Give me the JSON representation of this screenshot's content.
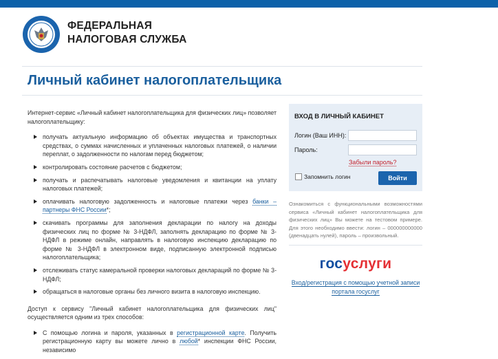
{
  "header": {
    "org_line1": "ФЕДЕРАЛЬНАЯ",
    "org_line2": "НАЛОГОВАЯ СЛУЖБА",
    "logo_icon": "fns-emblem-icon",
    "accent_color": "#0b61a9"
  },
  "page": {
    "title": "Личный кабинет налогоплательщика"
  },
  "intro": "Интернет-сервис «Личный кабинет налогоплательщика для физических лиц» позволяет налогоплательщику:",
  "features": [
    "получать актуальную информацию об объектах имущества и транспортных средствах, о суммах начисленных и уплаченных налоговых платежей, о наличии переплат, о задолженности по налогам перед бюджетом;",
    "контролировать состояние расчетов с бюджетом;",
    "получать и распечатывать налоговые уведомления и квитанции на уплату налоговых платежей;",
    "скачивать программы для заполнения декларации по налогу на доходы физических лиц по форме № 3-НДФЛ, заполнять декларацию по форме № 3-НДФЛ в режиме онлайн, направлять в налоговую инспекцию декларацию по форме № 3-НДФЛ в электронном виде, подписанную электронной подписью налогоплательщика;",
    "отслеживать статус камеральной проверки налоговых деклараций по форме № 3-НДФЛ;",
    "обращаться в налоговые органы без личного визита в налоговую инспекцию."
  ],
  "pay_item": {
    "text": "оплачивать налоговую задолженность и налоговые платежи через ",
    "link": "банки – партнеры ФНС России",
    "suffix": "*;"
  },
  "access": {
    "text": "Доступ к сервису \"Личный кабинет налогоплательщика для физических лиц\" осуществляется одним из трех способов:",
    "method1_pre": "С помощью логина и пароля, указанных в ",
    "method1_link": "регистрационной карте",
    "method1_mid": ". Получить регистрационную карту вы можете лично в ",
    "method1_link2": "любой",
    "method1_post": "* инспекции ФНС России, независимо"
  },
  "login": {
    "heading": "ВХОД В ЛИЧНЫЙ КАБИНЕТ",
    "login_label": "Логин (Ваш ИНН):",
    "password_label": "Пароль:",
    "login_value": "",
    "password_value": "",
    "forgot": "Забыли пароль?",
    "remember": "Запомнить логин",
    "submit": "Войти",
    "panel_color": "#e7eef6",
    "button_color": "#1b64ad"
  },
  "hint": "Ознакомиться с функциональными возможностями сервиса «Личный кабинет налогоплательщика для физических лиц» Вы можете на тестовом примере. Для этого необходимо ввести: логин – 000000000000 (двенадцать нулей), пароль – произвольный.",
  "gosuslugi": {
    "logo_part1": "гос",
    "logo_part2": "услуги",
    "link": "Вход/регистрация с помощью учетной записи портала госуслуг",
    "color_blue": "#0d4da0",
    "color_red": "#e52f34"
  }
}
